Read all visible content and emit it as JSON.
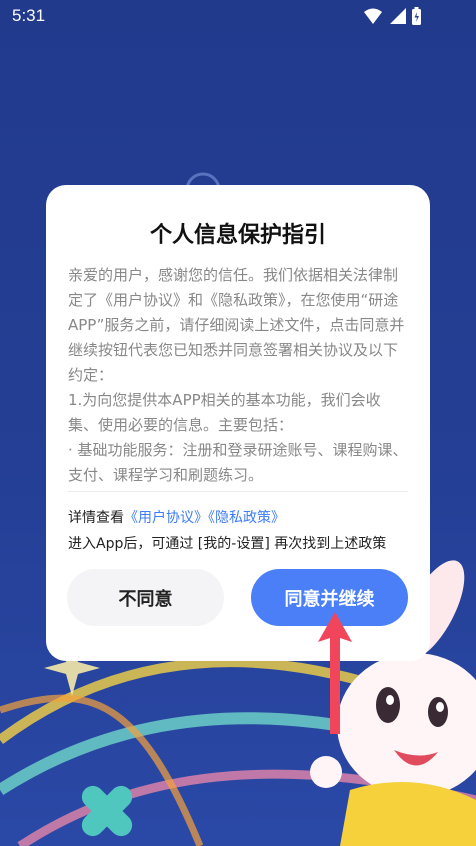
{
  "status_bar": {
    "time": "5:31",
    "icons": [
      "wifi-icon",
      "signal-icon",
      "battery-icon"
    ]
  },
  "dialog": {
    "title": "个人信息保护指引",
    "body": "亲爱的用户，感谢您的信任。我们依据相关法律制定了《用户协议》和《隐私政策》，在您使用“研途APP”服务之前，请仔细阅读上述文件，点击同意并继续按钮代表您已知悉并同意签署相关协议及以下约定：\n1.为向您提供本APP相关的基本功能，我们会收集、使用必要的信息。主要包括：\n· 基础功能服务：注册和登录研途账号、课程购课、支付、课程学习和刷题练习。",
    "detail_prefix": "详情查看",
    "user_agreement_link": "《用户协议》",
    "privacy_policy_link": "《隐私政策》",
    "entry_note": "进入App后，可通过 [我的-设置] 再次找到上述政策",
    "disagree_button": "不同意",
    "agree_button": "同意并继续"
  },
  "colors": {
    "background": "#243f95",
    "accent": "#4a7ff7",
    "link": "#3f7df6",
    "arrow": "#f0455a"
  }
}
